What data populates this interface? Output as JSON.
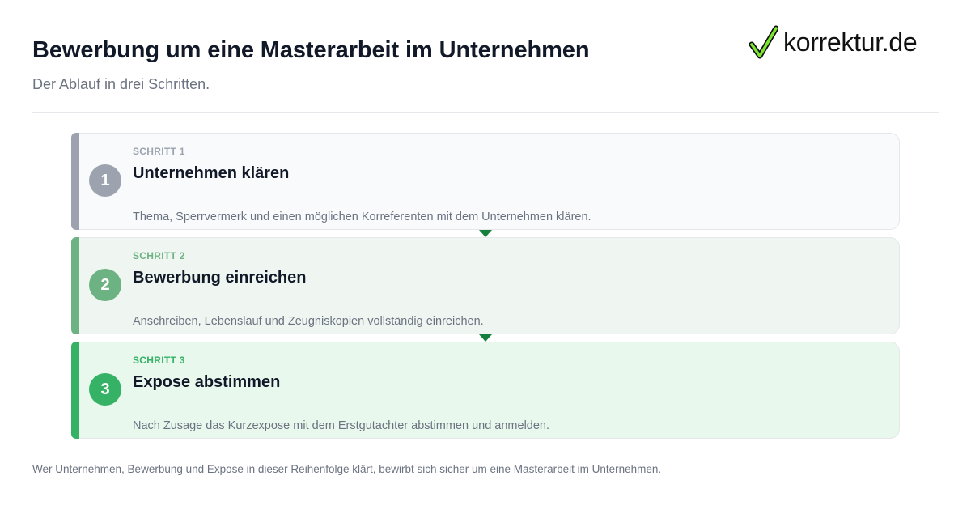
{
  "header": {
    "title": "Bewerbung um eine Masterarbeit im Unternehmen",
    "subtitle": "Der Ablauf in drei Schritten."
  },
  "logo": {
    "text": "korrektur.de",
    "icon": "checkmark-icon"
  },
  "steps": [
    {
      "number": "1",
      "kicker": "SCHRITT 1",
      "title": "Unternehmen klären",
      "description": "Thema, Sperrvermerk und einen möglichen Korreferenten mit dem Unternehmen klären.",
      "accent_color": "#9ca3af",
      "background_color": "#f8fafc"
    },
    {
      "number": "2",
      "kicker": "SCHRITT 2",
      "title": "Bewerbung einreichen",
      "description": "Anschreiben, Lebenslauf und Zeugniskopien vollständig einreichen.",
      "accent_color": "#6db283",
      "background_color": "#eff6f1"
    },
    {
      "number": "3",
      "kicker": "SCHRITT 3",
      "title": "Expose abstimmen",
      "description": "Nach Zusage das Kurzexpose mit dem Erstgutachter abstimmen und anmelden.",
      "accent_color": "#35b265",
      "background_color": "#e8f8ed"
    }
  ],
  "connector_color": "#15803d",
  "footer": {
    "text": "Wer Unternehmen, Bewerbung und Expose in dieser Reihenfolge klärt, bewirbt sich sicher um eine Masterarbeit im Unternehmen."
  }
}
